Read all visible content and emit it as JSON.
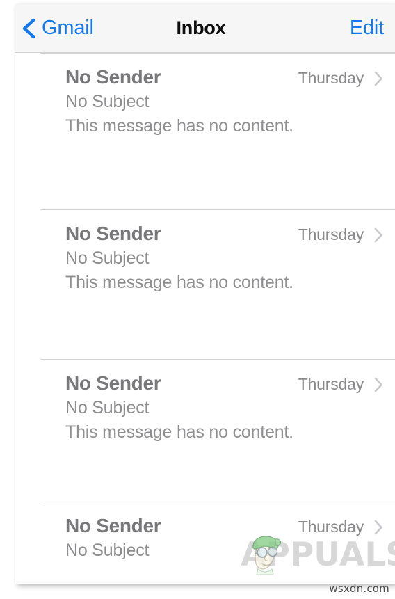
{
  "navbar": {
    "back_label": "Gmail",
    "back_icon": "chevron-left-icon",
    "title": "Inbox",
    "edit_label": "Edit",
    "accent_color": "#1479f0",
    "background_color": "#f6f6f6",
    "title_color": "#0d0d0d"
  },
  "list": {
    "separator_color": "#d3d3d5",
    "chevron_icon": "chevron-right-icon",
    "chevron_color": "#c7c7cc",
    "rows": [
      {
        "sender": "No Sender",
        "subject": "No Subject",
        "preview": "This message has no content.",
        "date": "Thursday"
      },
      {
        "sender": "No Sender",
        "subject": "No Subject",
        "preview": "This message has no content.",
        "date": "Thursday"
      },
      {
        "sender": "No Sender",
        "subject": "No Subject",
        "preview": "This message has no content.",
        "date": "Thursday"
      },
      {
        "sender": "No Sender",
        "subject": "No Subject",
        "preview": "",
        "date": "Thursday"
      }
    ]
  },
  "watermark": {
    "text": "APPUALS",
    "mascot_icon": "appuals-mascot-icon",
    "color": "#8c8c8e"
  },
  "footer": {
    "credit": "wsxdn.com"
  }
}
